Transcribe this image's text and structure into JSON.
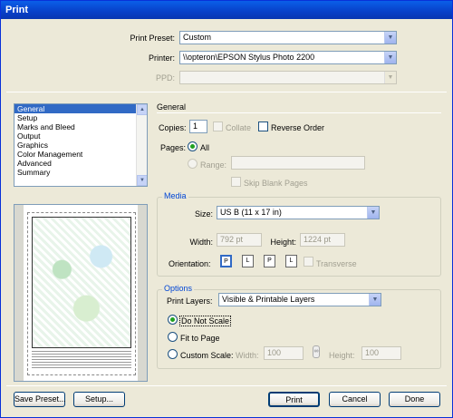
{
  "window": {
    "title": "Print"
  },
  "top": {
    "print_preset_label": "Print Preset:",
    "print_preset_value": "Custom",
    "printer_label": "Printer:",
    "printer_value": "\\\\opteron\\EPSON Stylus Photo 2200",
    "ppd_label": "PPD:",
    "ppd_value": ""
  },
  "sidebar": {
    "items": [
      {
        "label": "General"
      },
      {
        "label": "Setup"
      },
      {
        "label": "Marks and Bleed"
      },
      {
        "label": "Output"
      },
      {
        "label": "Graphics"
      },
      {
        "label": "Color Management"
      },
      {
        "label": "Advanced"
      },
      {
        "label": "Summary"
      }
    ],
    "selected": "General"
  },
  "general": {
    "section_title": "General",
    "copies_label": "Copies:",
    "copies_value": "1",
    "collate_label": "Collate",
    "reverse_order_label": "Reverse Order",
    "pages_label": "Pages:",
    "all_label": "All",
    "range_label": "Range:",
    "range_value": "",
    "skip_blank_label": "Skip Blank Pages"
  },
  "media": {
    "title": "Media",
    "size_label": "Size:",
    "size_value": "US B (11 x 17 in)",
    "width_label": "Width:",
    "width_value": "792 pt",
    "height_label": "Height:",
    "height_value": "1224 pt",
    "orientation_label": "Orientation:",
    "transverse_label": "Transverse"
  },
  "options": {
    "title": "Options",
    "print_layers_label": "Print Layers:",
    "print_layers_value": "Visible & Printable Layers",
    "do_not_scale_label": "Do Not Scale",
    "fit_to_page_label": "Fit to Page",
    "custom_scale_label": "Custom Scale:",
    "width_label": "Width:",
    "width_value": "100",
    "height_label": "Height:",
    "height_value": "100"
  },
  "buttons": {
    "save_preset": "Save Preset...",
    "setup": "Setup...",
    "print": "Print",
    "cancel": "Cancel",
    "done": "Done"
  },
  "colors": {
    "titlebar": "#0a5fe8",
    "selection": "#316ac5",
    "group_title": "#0046d5",
    "radio_dot": "#21a121"
  }
}
